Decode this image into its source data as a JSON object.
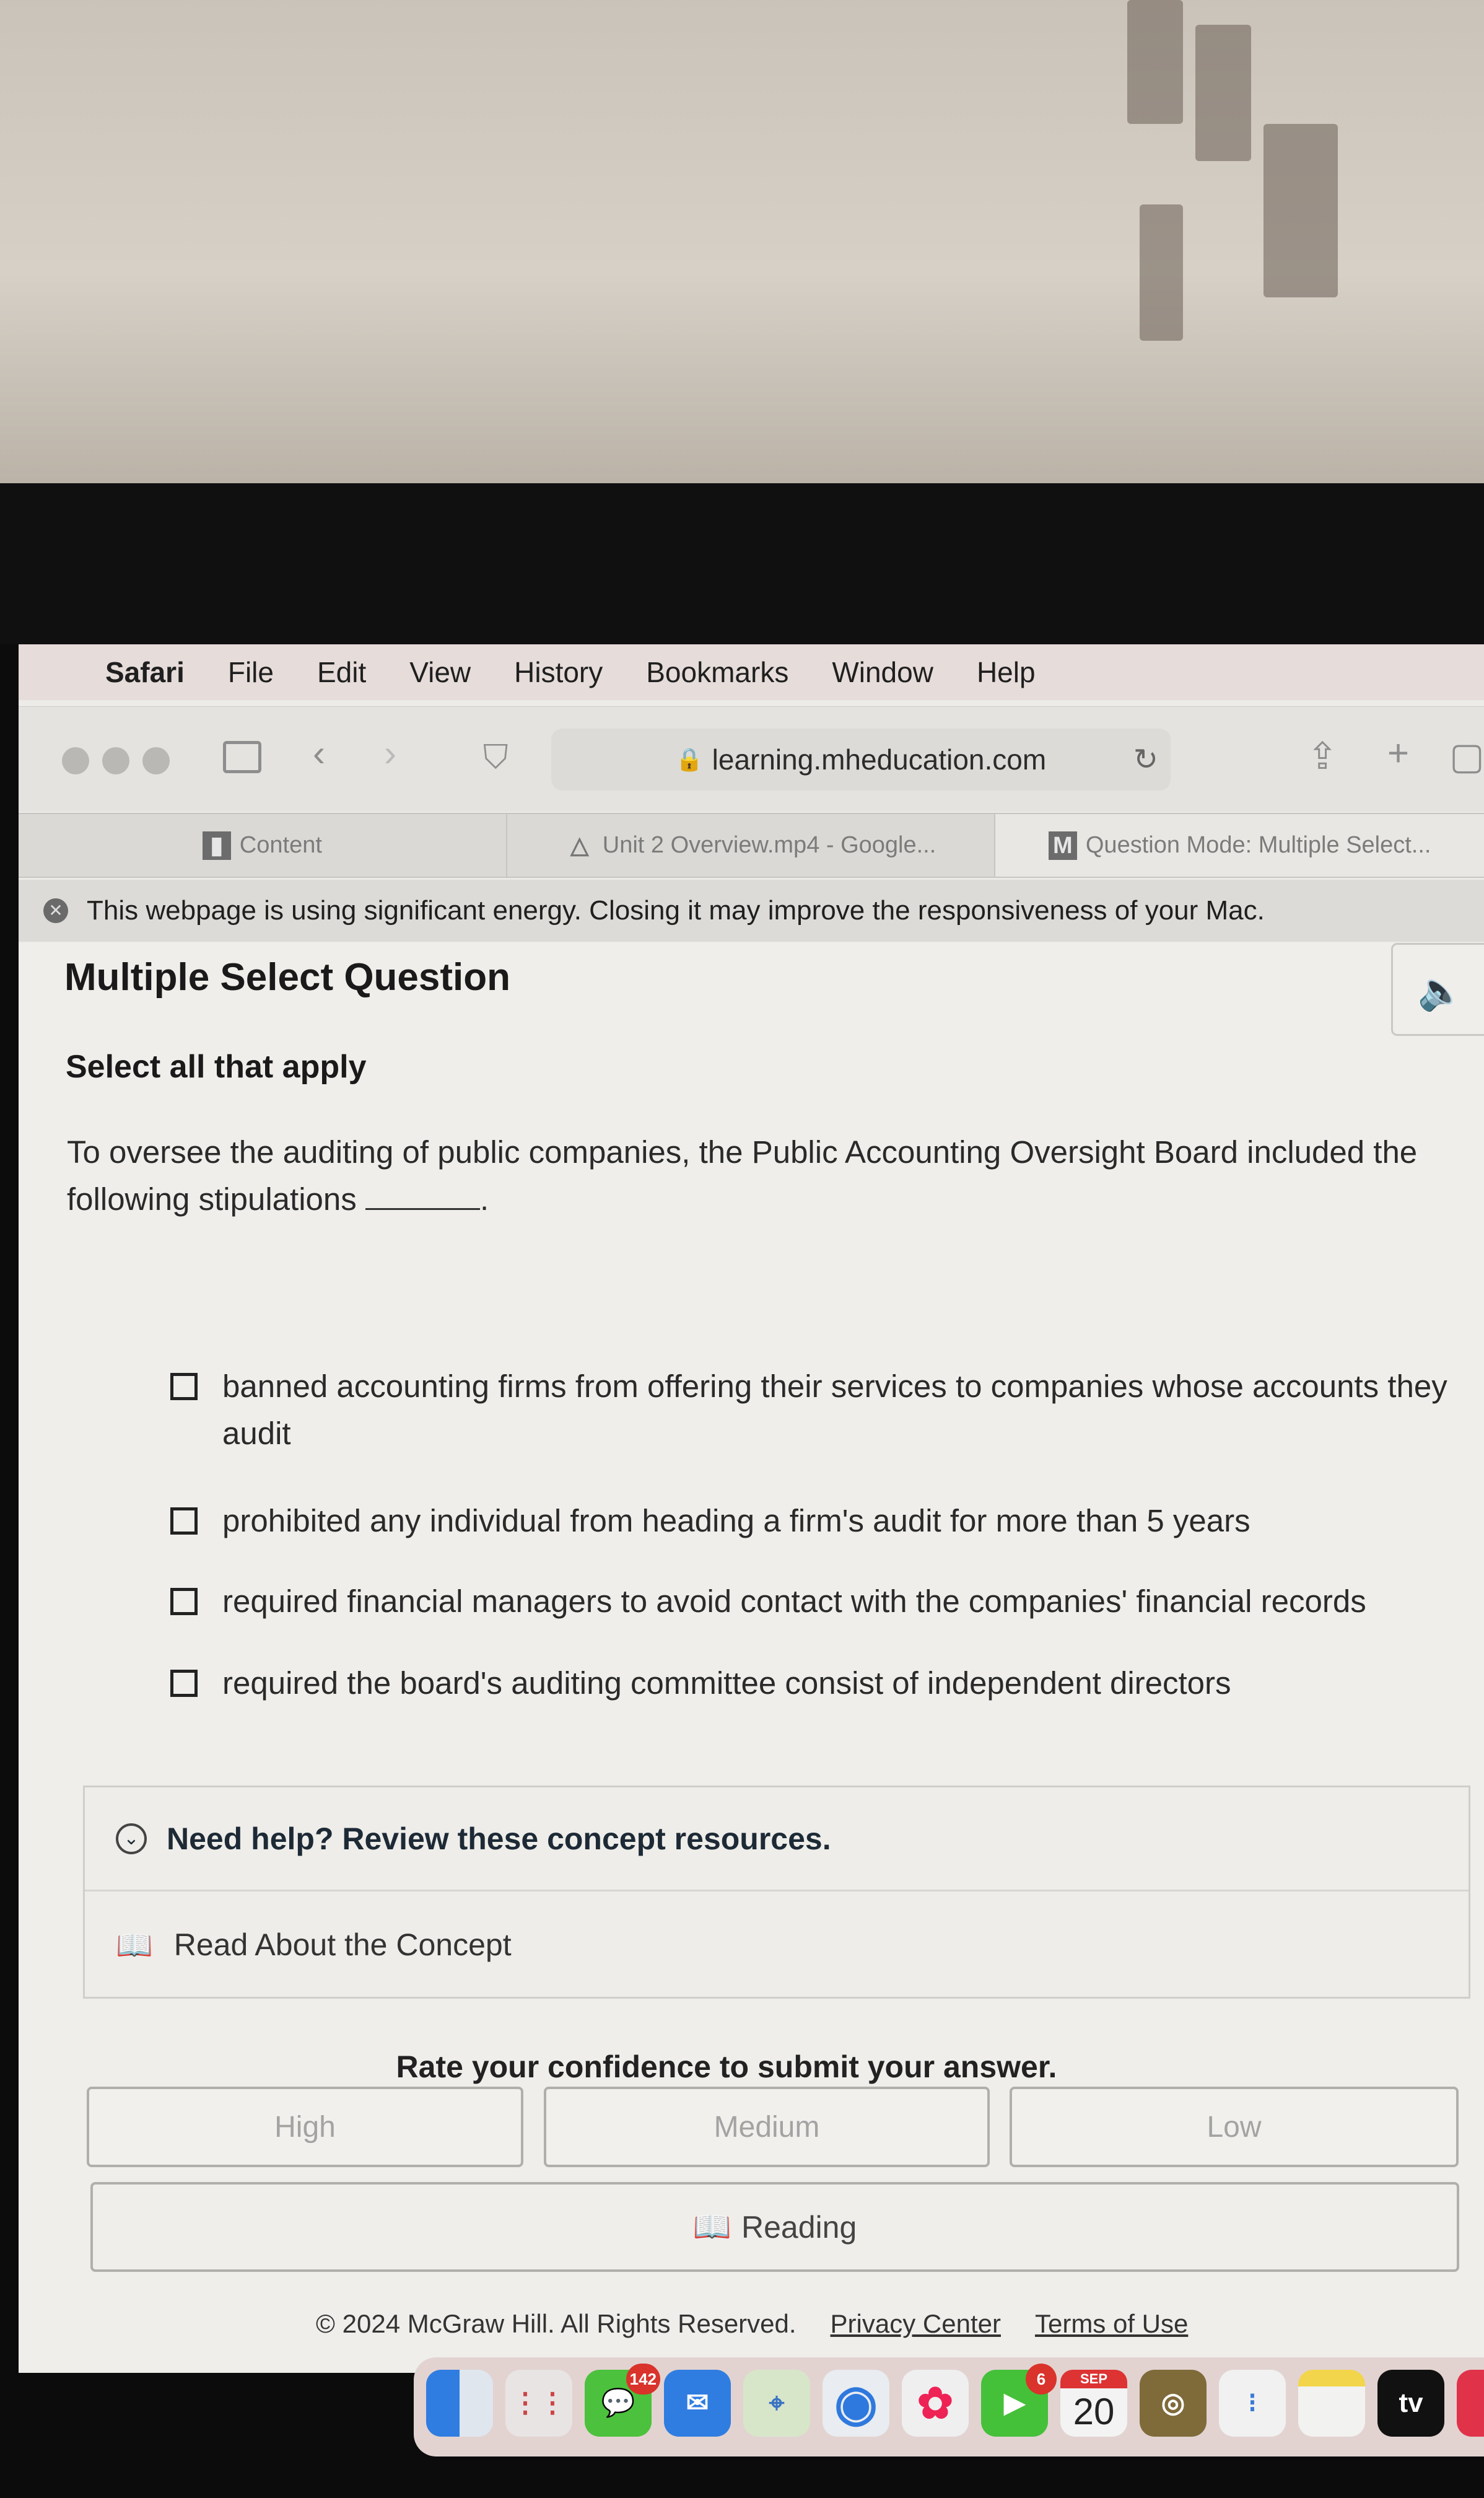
{
  "menubar": {
    "items": [
      "Safari",
      "File",
      "Edit",
      "View",
      "History",
      "Bookmarks",
      "Window",
      "Help"
    ]
  },
  "toolbar": {
    "url": "learning.mheducation.com"
  },
  "tabs": [
    {
      "label": "Content",
      "icon": "chart-icon"
    },
    {
      "label": "Unit 2 Overview.mp4 - Google...",
      "icon": "drive-icon"
    },
    {
      "label": "Question Mode: Multiple Select...",
      "icon": "m-icon"
    }
  ],
  "banner": {
    "text": "This webpage is using significant energy. Closing it may improve the responsiveness of your Mac."
  },
  "question": {
    "title": "Multiple Select Question",
    "instruction": "Select all that apply",
    "prompt": "To oversee the auditing of public companies, the Public Accounting Oversight Board included the following stipulations",
    "prompt_end": ".",
    "options": [
      {
        "label": "banned accounting firms from offering their services to companies whose accounts they audit",
        "checked": false
      },
      {
        "label": "prohibited any individual from heading a firm's audit for more than 5 years",
        "checked": false
      },
      {
        "label": "required financial managers to avoid contact with the companies' financial records",
        "checked": false
      },
      {
        "label": "required the board's auditing committee consist of independent directors",
        "checked": false
      }
    ]
  },
  "help": {
    "heading": "Need help? Review these concept resources.",
    "link": "Read About the Concept"
  },
  "confidence": {
    "prompt": "Rate your confidence to submit your answer.",
    "buttons": [
      "High",
      "Medium",
      "Low"
    ]
  },
  "reading_label": "Reading",
  "footer": {
    "copyright": "© 2024 McGraw Hill. All Rights Reserved.",
    "privacy": "Privacy Center",
    "terms": "Terms of Use"
  },
  "dock": {
    "messages_badge": "142",
    "facetime_badge": "6",
    "calendar_month": "SEP",
    "calendar_day": "20",
    "tv_label": "tv"
  }
}
